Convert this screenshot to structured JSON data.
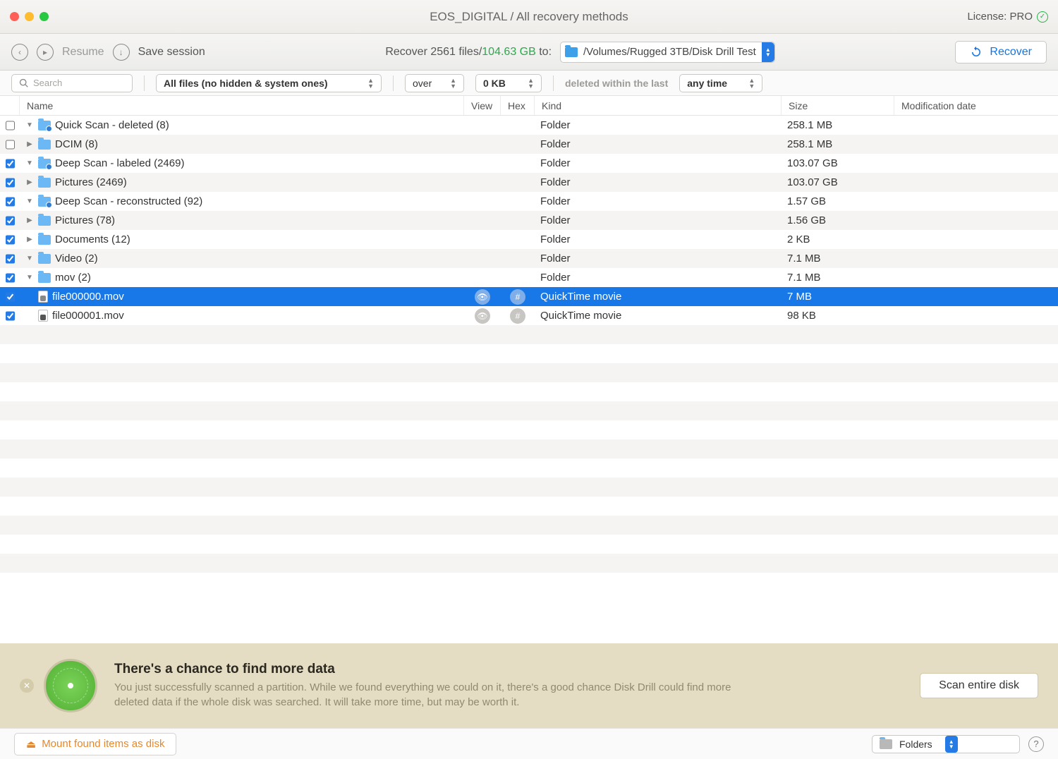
{
  "window": {
    "title": "EOS_DIGITAL / All recovery methods",
    "license": "License: PRO"
  },
  "toolbar": {
    "resume": "Resume",
    "save_session": "Save session",
    "recover_prefix": "Recover 2561 files/",
    "recover_size": "104.63 GB",
    "recover_suffix": " to:",
    "path": "/Volumes/Rugged 3TB/Disk Drill Test",
    "recover_btn": "Recover"
  },
  "filter": {
    "search_placeholder": "Search",
    "file_filter": "All files (no hidden & system ones)",
    "over": "over",
    "size": "0 KB",
    "deleted_label": "deleted within the last",
    "time": "any time"
  },
  "columns": {
    "name": "Name",
    "view": "View",
    "hex": "Hex",
    "kind": "Kind",
    "size": "Size",
    "mod": "Modification date"
  },
  "rows": [
    {
      "indent": 0,
      "checked": false,
      "expanded": true,
      "icon": "folder-dot",
      "name": "Quick Scan - deleted (8)",
      "kind": "Folder",
      "size": "258.1 MB",
      "alt": false,
      "sel": false
    },
    {
      "indent": 1,
      "checked": false,
      "expanded": false,
      "icon": "folder",
      "name": "DCIM (8)",
      "kind": "Folder",
      "size": "258.1 MB",
      "alt": true,
      "sel": false
    },
    {
      "indent": 0,
      "checked": true,
      "expanded": true,
      "icon": "folder-dot",
      "name": "Deep Scan - labeled (2469)",
      "kind": "Folder",
      "size": "103.07 GB",
      "alt": false,
      "sel": false
    },
    {
      "indent": 1,
      "checked": true,
      "expanded": false,
      "icon": "folder",
      "name": "Pictures (2469)",
      "kind": "Folder",
      "size": "103.07 GB",
      "alt": true,
      "sel": false
    },
    {
      "indent": 0,
      "checked": true,
      "expanded": true,
      "icon": "folder-dot",
      "name": "Deep Scan - reconstructed (92)",
      "kind": "Folder",
      "size": "1.57 GB",
      "alt": false,
      "sel": false
    },
    {
      "indent": 1,
      "checked": true,
      "expanded": false,
      "icon": "folder",
      "name": "Pictures (78)",
      "kind": "Folder",
      "size": "1.56 GB",
      "alt": true,
      "sel": false
    },
    {
      "indent": 1,
      "checked": true,
      "expanded": false,
      "icon": "folder",
      "name": "Documents (12)",
      "kind": "Folder",
      "size": "2 KB",
      "alt": false,
      "sel": false
    },
    {
      "indent": 1,
      "checked": true,
      "expanded": true,
      "icon": "folder",
      "name": "Video (2)",
      "kind": "Folder",
      "size": "7.1 MB",
      "alt": true,
      "sel": false
    },
    {
      "indent": 2,
      "checked": true,
      "expanded": true,
      "icon": "folder",
      "name": "mov (2)",
      "kind": "Folder",
      "size": "7.1 MB",
      "alt": false,
      "sel": false
    },
    {
      "indent": 3,
      "checked": true,
      "expanded": null,
      "icon": "file",
      "name": "file000000.mov",
      "kind": "QuickTime movie",
      "size": "7 MB",
      "alt": true,
      "sel": true,
      "actions": true
    },
    {
      "indent": 3,
      "checked": true,
      "expanded": null,
      "icon": "file",
      "name": "file000001.mov",
      "kind": "QuickTime movie",
      "size": "98 KB",
      "alt": false,
      "sel": false,
      "actions": true
    }
  ],
  "banner": {
    "title": "There's a chance to find more data",
    "body": "You just successfully scanned a partition. While we found everything we could on it, there's a good chance Disk Drill could find more deleted data if the whole disk was searched. It will take more time, but may be worth it.",
    "button": "Scan entire disk"
  },
  "footer": {
    "mount": "Mount found items as disk",
    "view": "Folders"
  }
}
